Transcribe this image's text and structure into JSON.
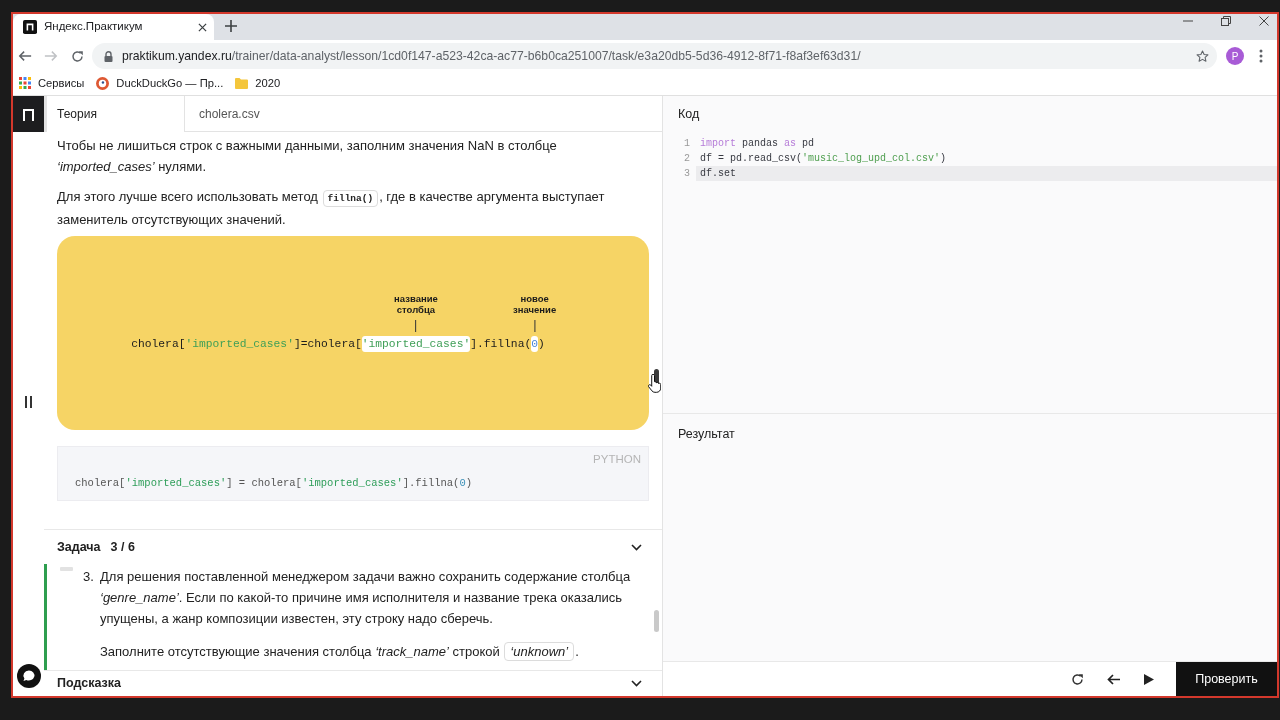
{
  "browser": {
    "tab_title": "Яндекс.Практикум",
    "url_host": "praktikum.yandex.ru",
    "url_path": "/trainer/data-analyst/lesson/1cd0f147-a523-42ca-ac77-b6b0ca251007/task/e3a20db5-5d36-4912-8f71-f8af3ef63d31/",
    "profile_initial": "P",
    "bookmarks": [
      {
        "kind": "apps",
        "label": "Сервисы"
      },
      {
        "kind": "site",
        "label": "DuckDuckGo — Пр..."
      },
      {
        "kind": "folder",
        "label": "2020"
      }
    ]
  },
  "lesson_tabs": [
    {
      "label": "Теория",
      "selected": true
    },
    {
      "label": "cholera.csv",
      "selected": false
    }
  ],
  "theory": {
    "paragraphs": [
      [
        {
          "kind": "text",
          "text": "Чтобы не лишиться строк с важными данными, заполним значения NaN в столбце *‘imported_cases’* нулями."
        }
      ],
      [
        {
          "kind": "text",
          "text": "Для этого лучше всего использовать метод "
        },
        {
          "kind": "code",
          "text": "fillna()"
        },
        {
          "kind": "text",
          "text": ", где в качестве аргумента выступает заменитель отсутствующих значений."
        }
      ]
    ],
    "figure": {
      "tokens": [
        {
          "kind": "plain",
          "text": "cholera[",
          "highlighted": false
        },
        {
          "kind": "string",
          "text": "'imported_cases'",
          "highlighted": false
        },
        {
          "kind": "plain",
          "text": "]=cholera[",
          "highlighted": false
        },
        {
          "kind": "string",
          "text": "'imported_cases'",
          "highlighted": true,
          "callout": "название столбца"
        },
        {
          "kind": "plain",
          "text": "].fillna(",
          "highlighted": false
        },
        {
          "kind": "number",
          "text": "0",
          "highlighted": true,
          "callout": "новое значение"
        },
        {
          "kind": "plain",
          "text": ")",
          "highlighted": false
        }
      ]
    },
    "code_block": {
      "language": "PYTHON",
      "tokens": [
        {
          "kind": "plain",
          "text": "cholera["
        },
        {
          "kind": "string",
          "text": "'imported_cases'"
        },
        {
          "kind": "plain",
          "text": "] = cholera["
        },
        {
          "kind": "string",
          "text": "'imported_cases'"
        },
        {
          "kind": "plain",
          "text": "].fillna("
        },
        {
          "kind": "number",
          "text": "0"
        },
        {
          "kind": "plain",
          "text": ")"
        }
      ]
    }
  },
  "task": {
    "title": "Задача",
    "counter": "3 / 6",
    "steps": [
      {
        "number": "3.",
        "paragraphs": [
          [
            {
              "kind": "text",
              "text": "Для решения поставленной менеджером задачи важно сохранить содержание столбца *‘genre_name’*. Если по какой-то причине имя исполнителя и название трека оказались упущены, а жанр композиции известен, эту строку надо сберечь."
            }
          ],
          [
            {
              "kind": "text",
              "text": "Заполните отсутствующие значения столбца *‘track_name’* строкой "
            },
            {
              "kind": "quoted",
              "text": "‘unknown’"
            },
            {
              "kind": "text",
              "text": "."
            }
          ]
        ]
      }
    ]
  },
  "hint": {
    "title": "Подсказка"
  },
  "editor": {
    "title": "Код",
    "lines": [
      {
        "number": "1",
        "active": false,
        "tokens": [
          {
            "kind": "keyword",
            "text": "import"
          },
          {
            "kind": "plain",
            "text": " pandas "
          },
          {
            "kind": "keyword",
            "text": "as"
          },
          {
            "kind": "plain",
            "text": " pd"
          }
        ]
      },
      {
        "number": "2",
        "active": false,
        "tokens": [
          {
            "kind": "plain",
            "text": "df = pd.read_csv("
          },
          {
            "kind": "string",
            "text": "'music_log_upd_col.csv'"
          },
          {
            "kind": "plain",
            "text": ")"
          }
        ]
      },
      {
        "number": "3",
        "active": true,
        "tokens": [
          {
            "kind": "plain",
            "text": "df.set"
          }
        ]
      }
    ]
  },
  "result": {
    "title": "Результат"
  },
  "actions": {
    "submit": "Проверить"
  }
}
